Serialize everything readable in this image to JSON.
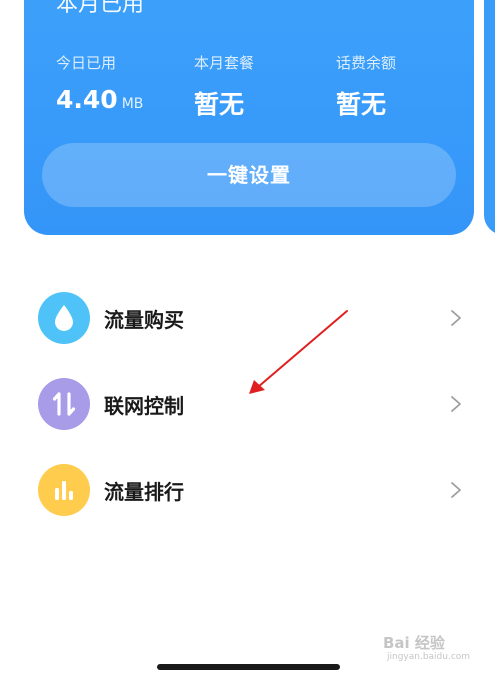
{
  "card": {
    "title": "本月已用",
    "stats": [
      {
        "label": "今日已用",
        "value": "4.40",
        "unit": "MB"
      },
      {
        "label": "本月套餐",
        "value": "暂无",
        "unit": ""
      },
      {
        "label": "话费余额",
        "value": "暂无",
        "unit": ""
      }
    ],
    "setup_button_label": "一键设置",
    "color": "#3a9cf9"
  },
  "menu": {
    "items": [
      {
        "label": "流量购买",
        "icon": "water-drop-icon",
        "color": "#4fc3f7"
      },
      {
        "label": "联网控制",
        "icon": "up-down-arrows-icon",
        "color": "#a89be8"
      },
      {
        "label": "流量排行",
        "icon": "bar-chart-icon",
        "color": "#ffcc4d"
      }
    ]
  },
  "watermark": {
    "text": "Bai 经验",
    "sub": "jingyan.baidu.com"
  }
}
